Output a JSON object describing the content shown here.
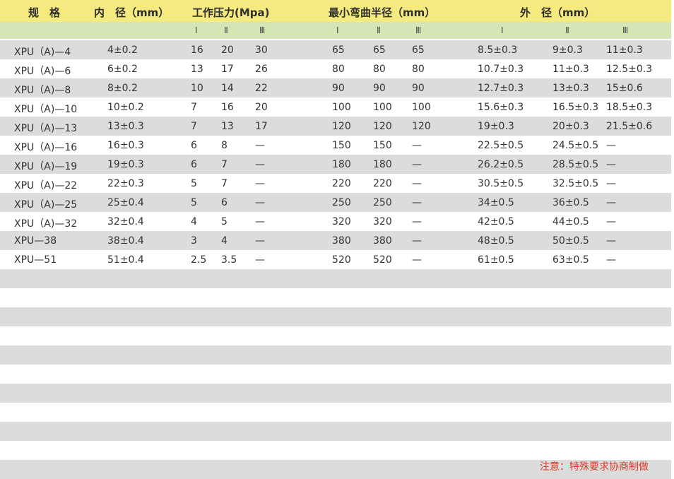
{
  "header": {
    "spec": "规　格",
    "inner": "内　径（mm）",
    "pressure": "工作压力(Mpa)",
    "bend": "最小弯曲半径（mm）",
    "outer": "外　径（mm）"
  },
  "subheader": {
    "r1": "Ⅰ",
    "r2": "Ⅱ",
    "r3": "Ⅲ"
  },
  "rows": [
    {
      "spec": "XPU（A)—4",
      "inner": "4±0.2",
      "p1": "16",
      "p2": "20",
      "p3": "30",
      "b1": "65",
      "b2": "65",
      "b3": "65",
      "o1": "8.5±0.3",
      "o2": "9±0.3",
      "o3": "11±0.3"
    },
    {
      "spec": "XPU（A)—6",
      "inner": "6±0.2",
      "p1": "13",
      "p2": "17",
      "p3": "26",
      "b1": "80",
      "b2": "80",
      "b3": "80",
      "o1": "10.7±0.3",
      "o2": "11±0.3",
      "o3": "12.5±0.3"
    },
    {
      "spec": "XPU（A)—8",
      "inner": "8±0.2",
      "p1": "10",
      "p2": "14",
      "p3": "22",
      "b1": "90",
      "b2": "90",
      "b3": "90",
      "o1": "12.7±0.3",
      "o2": "13±0.3",
      "o3": "15±0.6"
    },
    {
      "spec": "XPU（A)—10",
      "inner": "10±0.2",
      "p1": "7",
      "p2": "16",
      "p3": "20",
      "b1": "100",
      "b2": "100",
      "b3": "100",
      "o1": "15.6±0.3",
      "o2": "16.5±0.3",
      "o3": "18.5±0.3"
    },
    {
      "spec": "XPU（A)—13",
      "inner": "13±0.3",
      "p1": "7",
      "p2": "13",
      "p3": "17",
      "b1": "120",
      "b2": "120",
      "b3": "120",
      "o1": "19±0.3",
      "o2": "20±0.3",
      "o3": "21.5±0.6"
    },
    {
      "spec": "XPU（A)—16",
      "inner": "16±0.3",
      "p1": "6",
      "p2": "8",
      "p3": "—",
      "b1": "150",
      "b2": "150",
      "b3": "—",
      "o1": "22.5±0.5",
      "o2": "24.5±0.5",
      "o3": "—"
    },
    {
      "spec": "XPU（A)—19",
      "inner": "19±0.3",
      "p1": "6",
      "p2": "7",
      "p3": "—",
      "b1": "180",
      "b2": "180",
      "b3": "—",
      "o1": "26.2±0.5",
      "o2": "28.5±0.5",
      "o3": "—"
    },
    {
      "spec": "XPU（A)—22",
      "inner": "22±0.3",
      "p1": "5",
      "p2": "7",
      "p3": "—",
      "b1": "220",
      "b2": "220",
      "b3": "—",
      "o1": "30.5±0.5",
      "o2": "32.5±0.5",
      "o3": "—"
    },
    {
      "spec": "XPU（A)—25",
      "inner": "25±0.4",
      "p1": "5",
      "p2": "6",
      "p3": "—",
      "b1": "250",
      "b2": "250",
      "b3": "—",
      "o1": "34±0.5",
      "o2": "36±0.5",
      "o3": "—"
    },
    {
      "spec": "XPU（A)—32",
      "inner": "32±0.4",
      "p1": "4",
      "p2": "5",
      "p3": "—",
      "b1": "320",
      "b2": "320",
      "b3": "—",
      "o1": "42±0.5",
      "o2": "44±0.5",
      "o3": "—"
    },
    {
      "spec": "XPU—38",
      "inner": "38±0.4",
      "p1": "3",
      "p2": "4",
      "p3": "—",
      "b1": "380",
      "b2": "380",
      "b3": "—",
      "o1": "48±0.5",
      "o2": "50±0.5",
      "o3": "—"
    },
    {
      "spec": "XPU—51",
      "inner": "51±0.4",
      "p1": "2.5",
      "p2": "3.5",
      "p3": "—",
      "b1": "520",
      "b2": "520",
      "b3": "—",
      "o1": "61±0.5",
      "o2": "63±0.5",
      "o3": "—"
    }
  ],
  "empty_rows": 11,
  "note": "注意：特殊要求协商制做",
  "colors": {
    "header": "#f5ea80",
    "subheader": "#d5e6b6",
    "stripe": "#dcdcdc",
    "note": "#d83a2a"
  }
}
